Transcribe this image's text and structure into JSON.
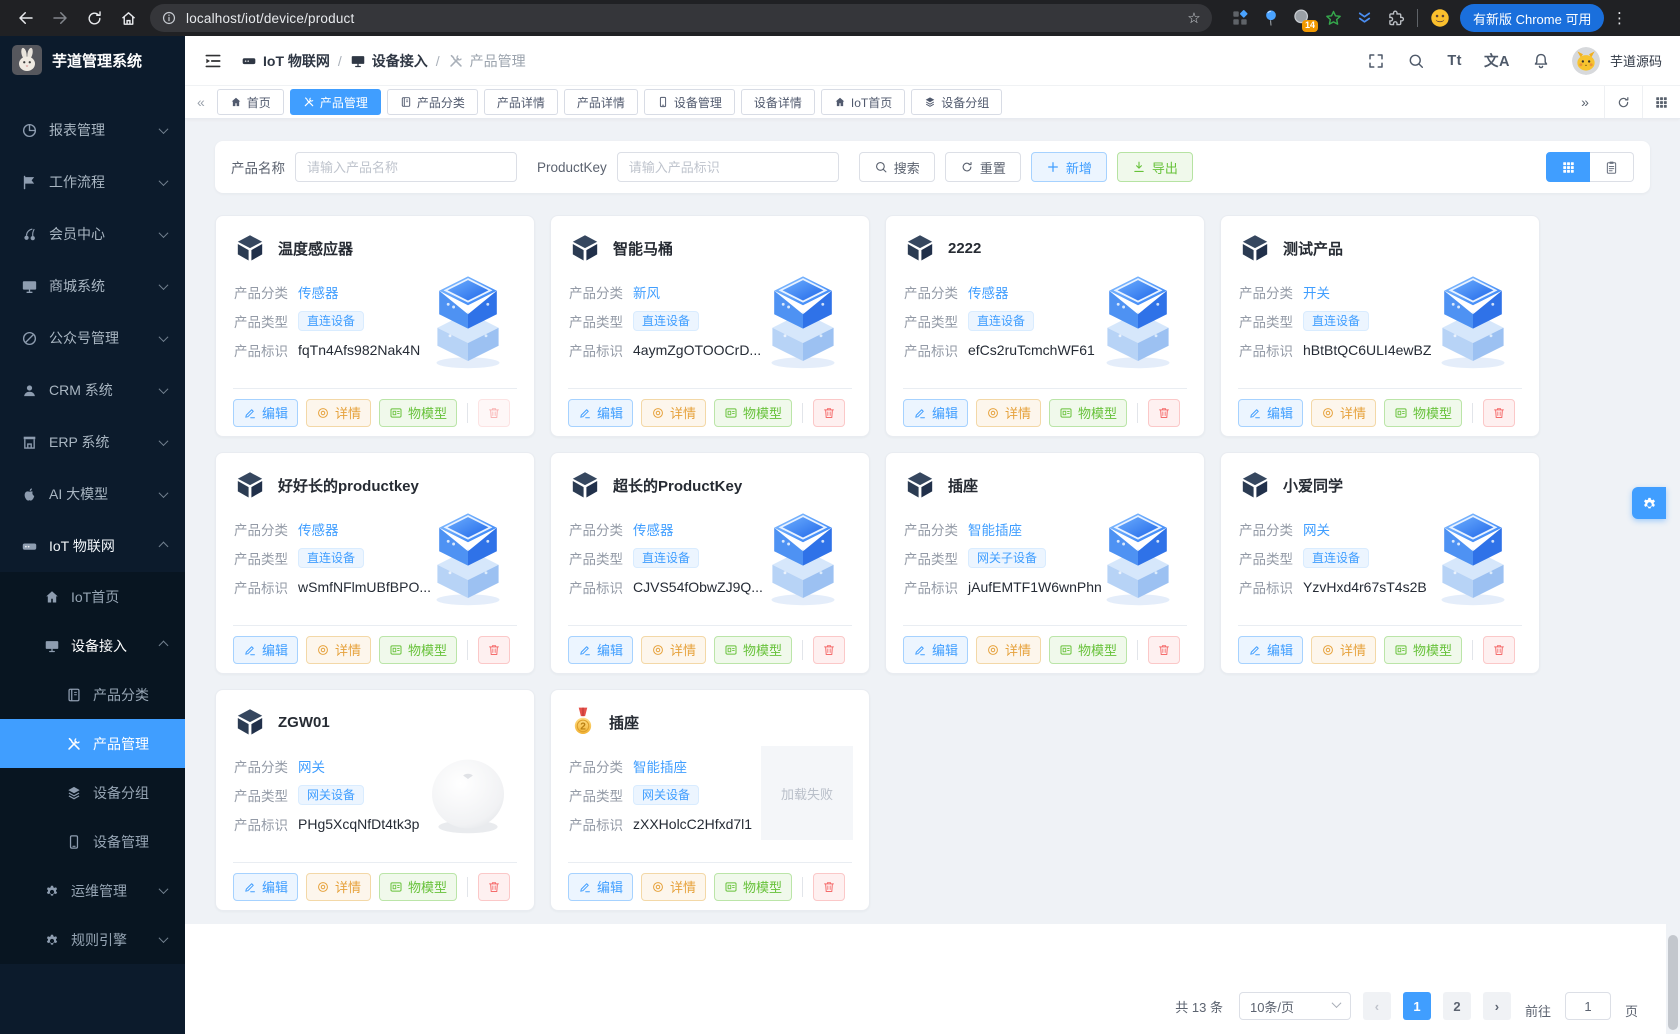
{
  "browser": {
    "url": "localhost/iot/device/product",
    "bookmark_glyph": "☆",
    "extension_badge": "14",
    "update_button": "有新版 Chrome 可用",
    "menu_glyph": "⋮"
  },
  "sidebar": {
    "app_title": "芋道管理系统",
    "menu": [
      {
        "label": "报表管理"
      },
      {
        "label": "工作流程"
      },
      {
        "label": "会员中心"
      },
      {
        "label": "商城系统"
      },
      {
        "label": "公众号管理"
      },
      {
        "label": "CRM 系统"
      },
      {
        "label": "ERP 系统"
      },
      {
        "label": "AI 大模型"
      },
      {
        "label": "IoT 物联网"
      }
    ],
    "submenu": [
      {
        "label": "IoT首页"
      },
      {
        "label": "设备接入"
      },
      {
        "label": "产品分类"
      },
      {
        "label": "产品管理"
      },
      {
        "label": "设备分组"
      },
      {
        "label": "设备管理"
      },
      {
        "label": "运维管理"
      },
      {
        "label": "规则引擎"
      }
    ]
  },
  "navbar": {
    "breadcrumb": [
      {
        "label": "IoT 物联网"
      },
      {
        "label": "设备接入"
      },
      {
        "label": "产品管理"
      }
    ],
    "separator": "/",
    "font_icon": "Tt",
    "lang_icon": "文A",
    "username": "芋道源码"
  },
  "tabbar": {
    "collapse_left": "«",
    "collapse_right": "»",
    "tabs": [
      {
        "label": "首页"
      },
      {
        "label": "产品管理"
      },
      {
        "label": "产品分类"
      },
      {
        "label": "产品详情"
      },
      {
        "label": "产品详情"
      },
      {
        "label": "设备管理"
      },
      {
        "label": "设备详情"
      },
      {
        "label": "IoT首页"
      },
      {
        "label": "设备分组"
      }
    ]
  },
  "filter": {
    "name_label": "产品名称",
    "name_placeholder": "请输入产品名称",
    "key_label": "ProductKey",
    "key_placeholder": "请输入产品标识",
    "search": "搜索",
    "reset": "重置",
    "add": "新增",
    "export": "导出"
  },
  "card_labels": {
    "category": "产品分类",
    "type": "产品类型",
    "key": "产品标识"
  },
  "actions": {
    "edit": "编辑",
    "detail": "详情",
    "model": "物模型"
  },
  "products": [
    {
      "name": "温度感应器",
      "category": "传感器",
      "type": "直连设备",
      "key": "fqTn4Afs982Nak4N"
    },
    {
      "name": "智能马桶",
      "category": "新风",
      "type": "直连设备",
      "key": "4aymZgOTOOCrD..."
    },
    {
      "name": "2222",
      "category": "传感器",
      "type": "直连设备",
      "key": "efCs2ruTcmchWF61"
    },
    {
      "name": "测试产品",
      "category": "开关",
      "type": "直连设备",
      "key": "hBtBtQC6ULI4ewBZ"
    },
    {
      "name": "好好长的productkey",
      "category": "传感器",
      "type": "直连设备",
      "key": "wSmfNFlmUBfBPO..."
    },
    {
      "name": "超长的ProductKey",
      "category": "传感器",
      "type": "直连设备",
      "key": "CJVS54fObwZJ9Q..."
    },
    {
      "name": "插座",
      "category": "智能插座",
      "type": "网关子设备",
      "key": "jAufEMTF1W6wnPhn"
    },
    {
      "name": "小爱同学",
      "category": "网关",
      "type": "直连设备",
      "key": "YzvHxd4r67sT4s2B"
    },
    {
      "name": "ZGW01",
      "category": "网关",
      "type": "网关设备",
      "key": "PHg5XcqNfDt4tk3p"
    },
    {
      "name": "插座",
      "category": "智能插座",
      "type": "网关设备",
      "key": "zXXHolcC2Hfxd7l1",
      "error": "加载失败",
      "medal_rank": "2"
    }
  ],
  "pagination": {
    "total": "共 13 条",
    "page_size": "10条/页",
    "prev": "‹",
    "next": "›",
    "pages": [
      {
        "label": "1"
      },
      {
        "label": "2"
      }
    ],
    "goto_label": "前往",
    "goto_value": "1",
    "goto_unit": "页"
  }
}
